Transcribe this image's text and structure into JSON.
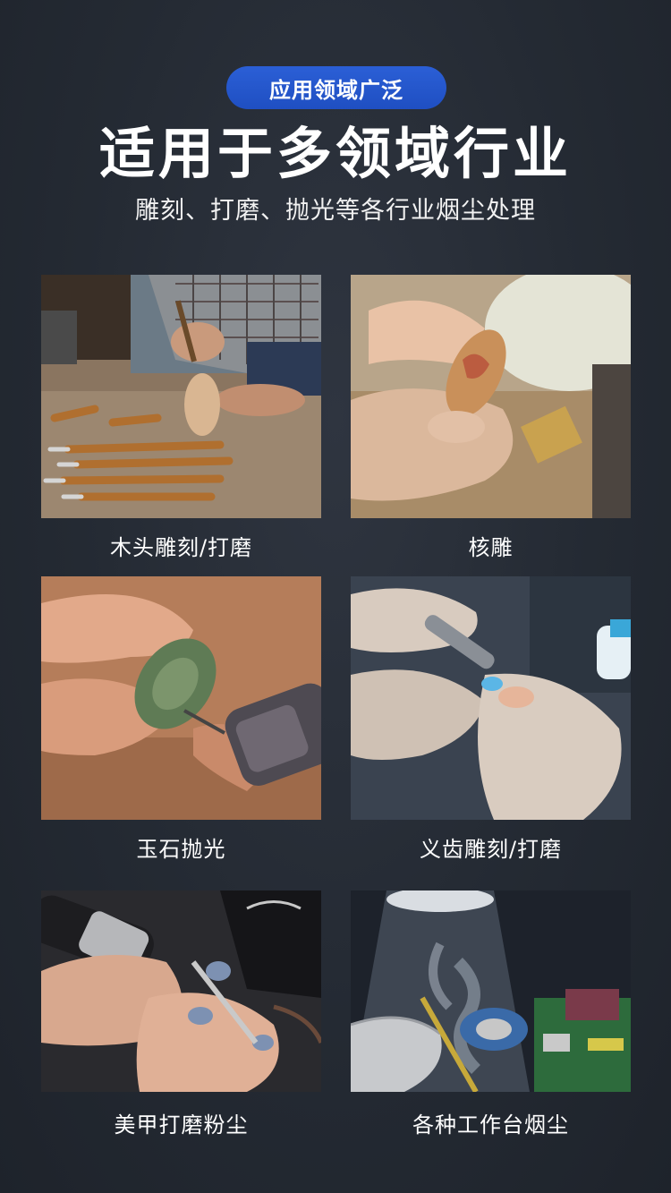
{
  "header": {
    "badge": "应用领域广泛",
    "title": "适用于多领域行业",
    "subtitle": "雕刻、打磨、抛光等各行业烟尘处理"
  },
  "cards": [
    {
      "caption": "木头雕刻/打磨",
      "icon": "wood-carving-photo"
    },
    {
      "caption": "核雕",
      "icon": "nut-carving-photo"
    },
    {
      "caption": "玉石抛光",
      "icon": "jade-polishing-photo"
    },
    {
      "caption": "义齿雕刻/打磨",
      "icon": "denture-carving-photo"
    },
    {
      "caption": "美甲打磨粉尘",
      "icon": "nail-grinding-photo"
    },
    {
      "caption": "各种工作台烟尘",
      "icon": "workbench-smoke-photo"
    }
  ],
  "colors": {
    "background": "#262c35",
    "badge": "#2456cc",
    "text": "#ffffff"
  }
}
